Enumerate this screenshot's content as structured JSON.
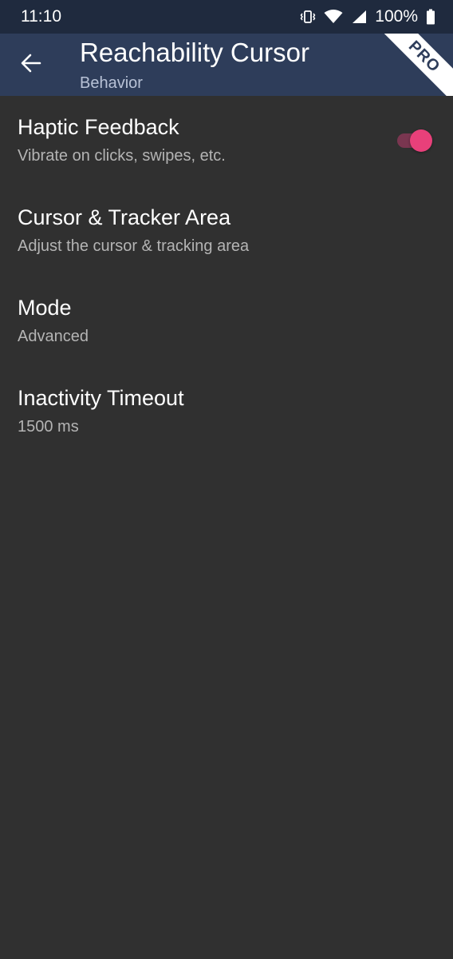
{
  "status_bar": {
    "time": "11:10",
    "battery_percent": "100%",
    "icons": [
      "vibrate-icon",
      "wifi-icon",
      "signal-icon",
      "battery-icon"
    ]
  },
  "app_bar": {
    "back_icon": "arrow-left-icon",
    "title": "Reachability Cursor",
    "subtitle": "Behavior",
    "badge": "PRO"
  },
  "settings": {
    "items": [
      {
        "title": "Haptic Feedback",
        "summary": "Vibrate on clicks, swipes, etc.",
        "toggle_on": true
      },
      {
        "title": "Cursor & Tracker Area",
        "summary": "Adjust the cursor & tracking area"
      },
      {
        "title": "Mode",
        "summary": "Advanced"
      },
      {
        "title": "Inactivity Timeout",
        "summary": "1500 ms"
      }
    ]
  },
  "colors": {
    "status_bar_bg": "#1f2a3e",
    "app_bar_bg": "#2e3d5a",
    "background": "#303030",
    "accent": "#e8407a"
  }
}
